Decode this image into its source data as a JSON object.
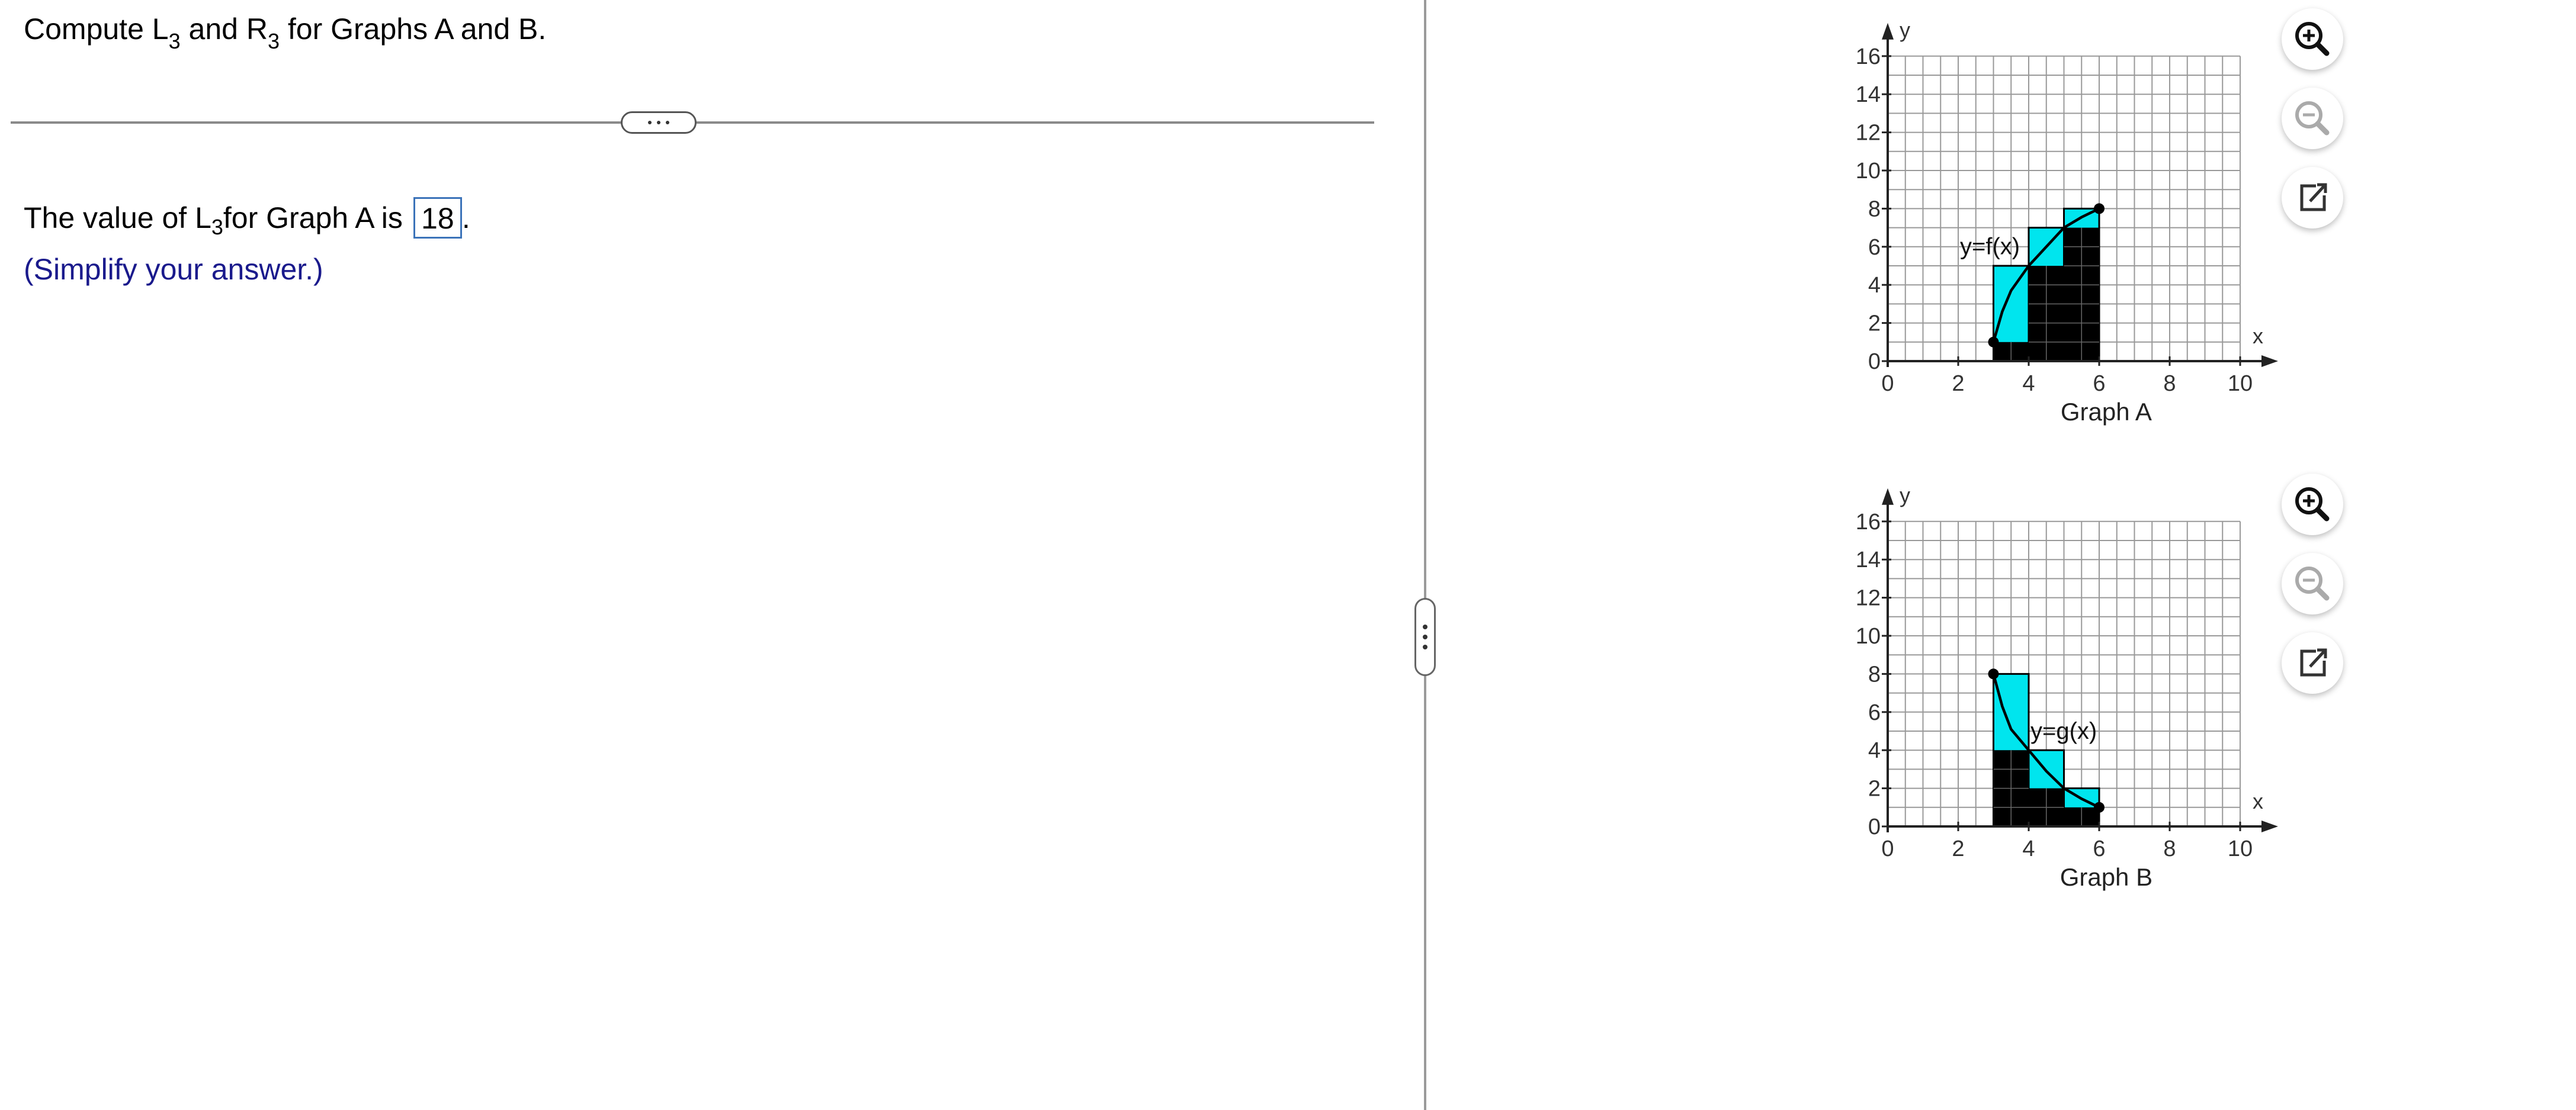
{
  "question": {
    "text_a": "Compute L",
    "sub_a": "3",
    "text_b": " and R",
    "sub_b": "3",
    "text_c": " for Graphs A and B."
  },
  "answer": {
    "prefix": "The value of L",
    "sub": "3",
    "mid": " for Graph A is",
    "value": "18",
    "suffix": ".",
    "hint": "(Simplify your answer.)"
  },
  "graph_a": {
    "caption": "Graph A",
    "curve_label": "y=f(x)",
    "xlabel": "x",
    "ylabel": "y"
  },
  "graph_b": {
    "caption": "Graph B",
    "curve_label": "y=g(x)",
    "xlabel": "x",
    "ylabel": "y"
  },
  "toolbar": {
    "zoom_in": "zoom-in-icon",
    "zoom_out": "zoom-out-icon",
    "popout": "popout-icon"
  },
  "chart_data": [
    {
      "type": "bar",
      "title": "Graph A",
      "curve_label": "y=f(x)",
      "xlabel": "x",
      "ylabel": "y",
      "xlim": [
        0,
        10
      ],
      "ylim": [
        0,
        16
      ],
      "x_ticks": [
        0,
        2,
        4,
        6,
        8,
        10
      ],
      "y_ticks": [
        0,
        2,
        4,
        6,
        8,
        10,
        12,
        14,
        16
      ],
      "curve": [
        [
          3,
          1
        ],
        [
          3.25,
          2.6
        ],
        [
          3.5,
          3.7
        ],
        [
          4,
          5
        ],
        [
          4.5,
          6
        ],
        [
          5,
          7
        ],
        [
          5.5,
          7.55
        ],
        [
          6,
          8
        ]
      ],
      "endpoints": [
        [
          3,
          1
        ],
        [
          6,
          8
        ]
      ],
      "rect_edges": [
        3,
        4,
        5,
        6
      ],
      "left_heights": [
        1,
        5,
        7
      ],
      "right_heights": [
        5,
        7,
        8
      ],
      "colors": {
        "overlap": "#000000",
        "excess": "#00e5ee"
      }
    },
    {
      "type": "bar",
      "title": "Graph B",
      "curve_label": "y=g(x)",
      "xlabel": "x",
      "ylabel": "y",
      "xlim": [
        0,
        10
      ],
      "ylim": [
        0,
        16
      ],
      "x_ticks": [
        0,
        2,
        4,
        6,
        8,
        10
      ],
      "y_ticks": [
        0,
        2,
        4,
        6,
        8,
        10,
        12,
        14,
        16
      ],
      "curve": [
        [
          3,
          8
        ],
        [
          3.25,
          6.3
        ],
        [
          3.5,
          5.1
        ],
        [
          4,
          4
        ],
        [
          4.5,
          2.9
        ],
        [
          5,
          2
        ],
        [
          5.5,
          1.45
        ],
        [
          6,
          1
        ]
      ],
      "endpoints": [
        [
          3,
          8
        ],
        [
          6,
          1
        ]
      ],
      "rect_edges": [
        3,
        4,
        5,
        6
      ],
      "left_heights": [
        8,
        4,
        2
      ],
      "right_heights": [
        4,
        2,
        1
      ],
      "colors": {
        "overlap": "#000000",
        "excess": "#00e5ee"
      }
    }
  ]
}
